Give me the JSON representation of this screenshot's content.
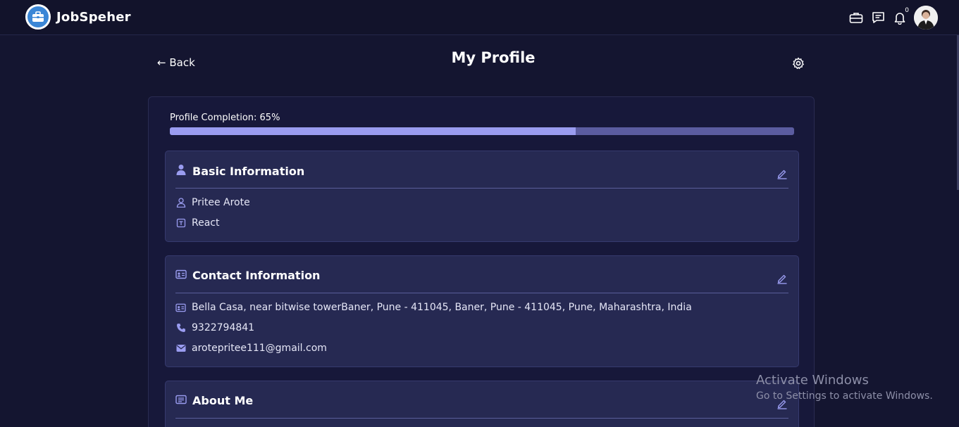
{
  "brand": {
    "name": "JobSpeher"
  },
  "nav": {
    "notification_count": "0"
  },
  "page": {
    "back_label": "← Back",
    "title": "My Profile"
  },
  "profile": {
    "completion_label": "Profile Completion: 65%",
    "completion_percent": 65
  },
  "sections": {
    "basic": {
      "title": "Basic Information",
      "name": "Pritee Arote",
      "skill": "React"
    },
    "contact": {
      "title": "Contact Information",
      "address": "Bella Casa, near bitwise towerBaner, Pune - 411045, Baner, Pune - 411045, Pune, Maharashtra, India",
      "phone": "9322794841",
      "email": "arotepritee111@gmail.com"
    },
    "about": {
      "title": "About Me"
    }
  },
  "watermark": {
    "title": "Activate Windows",
    "subtitle": "Go to Settings to activate Windows."
  },
  "colors": {
    "accent": "#9a9cf0",
    "background": "#141530",
    "card": "#262952"
  },
  "icons": [
    "logo-briefcase-icon",
    "briefcase-icon",
    "message-icon",
    "bell-icon",
    "settings-gear-icon",
    "user-icon",
    "edit-icon",
    "id-card-icon",
    "phone-icon",
    "mail-icon",
    "note-icon"
  ]
}
